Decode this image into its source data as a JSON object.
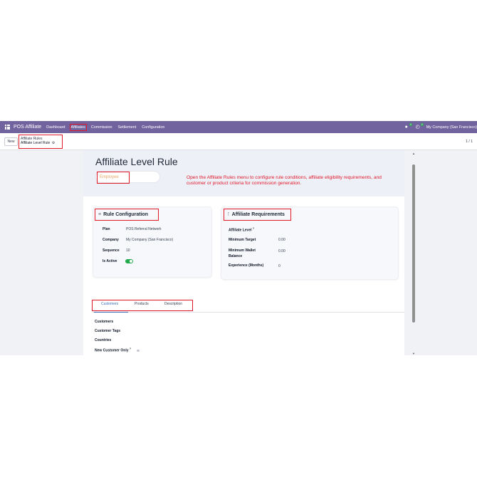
{
  "navbar": {
    "app_name": "POS Affiliate",
    "menus": [
      "Dashboard",
      "Affiliates",
      "Commission",
      "Settlement",
      "Configuration"
    ],
    "chat_count": "4",
    "activity_count": "4",
    "company": "My Company (San Francisco)"
  },
  "control_panel": {
    "new_label": "New",
    "breadcrumb_parent": "Affiliate Rules",
    "breadcrumb_current": "Affiliate Level Rule",
    "pager": "1 / 1"
  },
  "form": {
    "title": "Affiliate Level Rule",
    "tag": "Employee",
    "note": "Open the Affiliate Rules menu to configure rule conditions, affiliate eligibility requirements, and customer or product criteria for commission generation.",
    "rule_config": {
      "title": "Rule Configuration",
      "plan_label": "Plan",
      "plan_value": "POS Referral Network",
      "company_label": "Company",
      "company_value": "My Company (San Francisco)",
      "sequence_label": "Sequence",
      "sequence_value": "10",
      "active_label": "Is Active",
      "active": true
    },
    "requirements": {
      "title": "Affiliate Requirements",
      "level_label": "Affiliate Level",
      "level_help": "?",
      "target_label": "Minimum Target",
      "target_value": "0.00",
      "wallet_label_1": "Minimum Wallet",
      "wallet_label_2": "Balance",
      "wallet_value": "0.00",
      "experience_label": "Experience (Months)",
      "experience_value": "0"
    },
    "tabs": [
      "Customers",
      "Products",
      "Description"
    ],
    "customers_tab": {
      "customers_label": "Customers",
      "tags_label": "Customer Tags",
      "countries_label": "Countries",
      "new_only_label": "New Customer Only",
      "new_only_help": "?"
    }
  },
  "colors": {
    "navbar": "#71639e",
    "highlight": "#e0182a",
    "toggle_on": "#22a94b",
    "active_tab": "#3b6fb6",
    "tag_text": "#e8a867"
  }
}
